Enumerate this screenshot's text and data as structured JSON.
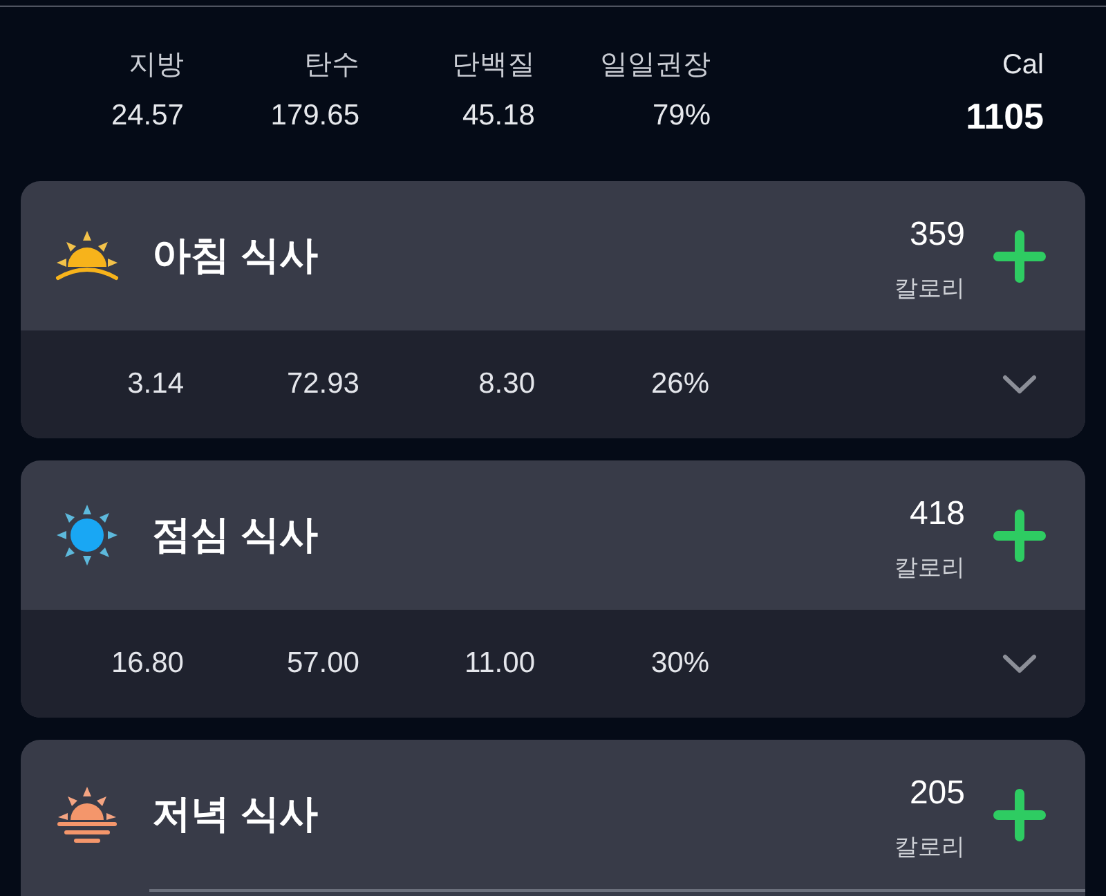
{
  "summary": {
    "columns": [
      {
        "label": "지방",
        "value": "24.57"
      },
      {
        "label": "탄수",
        "value": "179.65"
      },
      {
        "label": "단백질",
        "value": "45.18"
      },
      {
        "label": "일일권장",
        "value": "79%"
      }
    ],
    "calories": {
      "label": "Cal",
      "value": "1105"
    }
  },
  "meals": [
    {
      "kind": "sunrise",
      "title": "아침 식사",
      "calories": "359",
      "calories_label": "칼로리",
      "nutrients": [
        "3.14",
        "72.93",
        "8.30",
        "26%"
      ]
    },
    {
      "kind": "sun",
      "title": "점심 식사",
      "calories": "418",
      "calories_label": "칼로리",
      "nutrients": [
        "16.80",
        "57.00",
        "11.00",
        "30%"
      ]
    },
    {
      "kind": "sunset",
      "title": "저녁 식사",
      "calories": "205",
      "calories_label": "칼로리"
    }
  ]
}
